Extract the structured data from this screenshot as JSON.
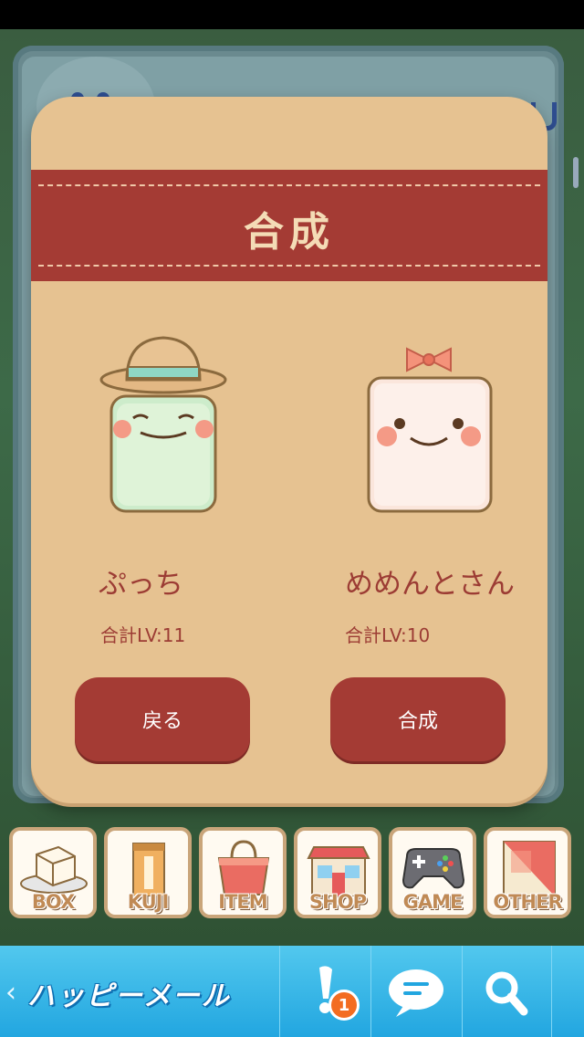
{
  "dialog": {
    "title": "合成",
    "characters": [
      {
        "name": "ぷっち",
        "level": "合計LV:11"
      },
      {
        "name": "めめんとさん",
        "level": "合計LV:10"
      }
    ],
    "buttons": {
      "back": "戻る",
      "combine": "合成"
    }
  },
  "menu": {
    "items": [
      {
        "label": "BOX",
        "icon": "tofu-plate-icon"
      },
      {
        "label": "KUJI",
        "icon": "omikuji-box-icon"
      },
      {
        "label": "ITEM",
        "icon": "tote-bag-icon"
      },
      {
        "label": "SHOP",
        "icon": "shop-building-icon"
      },
      {
        "label": "GAME",
        "icon": "gamepad-icon"
      },
      {
        "label": "OTHER",
        "icon": "folded-card-icon"
      }
    ]
  },
  "bottom_bar": {
    "brand": "ハッピーメール",
    "notification_count": "1",
    "icons": [
      "notification-icon",
      "chat-icon",
      "search-icon"
    ]
  },
  "colors": {
    "ribbon": "#a43b34",
    "dialog": "#e6c291",
    "text_accent": "#9c3c34",
    "bottom_bar": "#2bb0e6",
    "badge": "#f36c21"
  }
}
